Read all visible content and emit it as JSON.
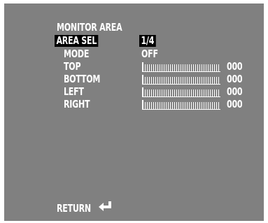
{
  "menu": {
    "title": "MONITOR AREA",
    "area_sel": {
      "label": "AREA SEL",
      "value": "1/4"
    },
    "mode": {
      "label": "MODE",
      "value": "OFF"
    },
    "sliders": [
      {
        "label": "TOP",
        "value": "000",
        "level": 0
      },
      {
        "label": "BOTTOM",
        "value": "000",
        "level": 0
      },
      {
        "label": "LEFT",
        "value": "000",
        "level": 0
      },
      {
        "label": "RIGHT",
        "value": "000",
        "level": 0
      }
    ],
    "return_label": "RETURN",
    "return_icon": "enter-arrow-icon"
  },
  "colors": {
    "background": "#808080",
    "text": "#ffffff",
    "highlight": "#000000"
  }
}
